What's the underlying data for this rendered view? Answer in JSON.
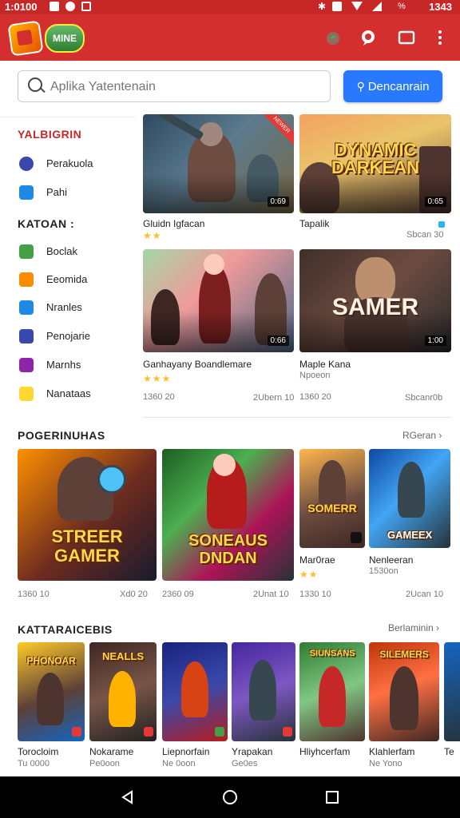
{
  "status_bar": {
    "time": "1:0100",
    "right": "1343"
  },
  "app_bar": {
    "logo_text": "MINE",
    "icons": [
      "tag-icon",
      "chat-icon",
      "window-icon",
      "more-icon"
    ]
  },
  "search": {
    "placeholder": "Aplika Yatentenain",
    "button_label": "Dencanrain"
  },
  "sidebar": {
    "section1_title": "YALBIGRIN",
    "section1_items": [
      {
        "label": "Perakuola",
        "icon": "circle-icon",
        "color": "#3949ab"
      },
      {
        "label": "Pahi",
        "icon": "folder-icon",
        "color": "#1e88e5"
      }
    ],
    "section2_title": "KATOAN :",
    "section2_items": [
      {
        "label": "Boclak",
        "icon": "book-icon",
        "color": "#43a047"
      },
      {
        "label": "Eeomida",
        "icon": "box-icon",
        "color": "#fb8c00"
      },
      {
        "label": "Nranles",
        "icon": "chart-icon",
        "color": "#1e88e5"
      },
      {
        "label": "Penojarie",
        "icon": "game-icon",
        "color": "#3949ab"
      },
      {
        "label": "Marnhs",
        "icon": "game-icon",
        "color": "#8e24aa"
      },
      {
        "label": "Nanataas",
        "icon": "puzzle-icon",
        "color": "#fdd835"
      }
    ]
  },
  "featured": [
    {
      "title": "Gluidn Igfacan",
      "rating": "★★",
      "sub_left": "",
      "sub_right": "",
      "badge": "0:69",
      "ribbon": "NEWER",
      "art": ""
    },
    {
      "title": "Tapalik",
      "rating": "",
      "sub_left": "",
      "sub_right": "Sbcan 30",
      "badge": "0:65",
      "ribbon": "",
      "art": "DYNAMIC DARKEAN"
    },
    {
      "title": "Ganhayany Boandlemare",
      "rating": "★★★",
      "sub_left": "1360 20",
      "sub_right": "2Ubern 10",
      "badge": "0:66",
      "ribbon": "",
      "art": ""
    },
    {
      "title": "Maple Kana",
      "rating": "",
      "sub_left": "Npoeon",
      "sub_right": "Sbcanr0b",
      "sub2": "1360 20",
      "badge": "1:00",
      "ribbon": "",
      "art": "SAMER"
    }
  ],
  "popular": {
    "title": "POGERINUHAS",
    "link": "RGeran",
    "items": [
      {
        "title": "",
        "art": "STREER GAMER",
        "sub_left": "1360 10",
        "sub_right": "Xd0 20"
      },
      {
        "title": "",
        "art": "SONEAUS DNDAN",
        "sub_left": "2360 09",
        "sub_right": "2Unat 10"
      },
      {
        "title": "Mar0rae",
        "rating": "★★",
        "art": "SOMERR",
        "sub_left": "1330 10"
      },
      {
        "title": "Nenleeran",
        "rating": "",
        "art": "GAMEEX",
        "sub_left": "1530on",
        "sub_right": "2Ucan 10"
      }
    ]
  },
  "categories": {
    "title": "KATTARAICEBIS",
    "link": "Berlaminin",
    "items": [
      {
        "title": "Torocloim",
        "sub": "Tu 0000",
        "art": "PHONOAR"
      },
      {
        "title": "Nokarame",
        "sub": "Pe0oon",
        "art": "NEALLS"
      },
      {
        "title": "Liepnorfain",
        "sub": "Ne 0oon",
        "art": ""
      },
      {
        "title": "Yrapakan",
        "sub": "Ge0es",
        "art": ""
      },
      {
        "title": "Hliyhcerfam",
        "sub": "",
        "art": "SIUNSANS"
      },
      {
        "title": "Klahlerfam",
        "sub": "Ne Yono",
        "art": "SILEMERS"
      },
      {
        "title": "Te",
        "sub": "",
        "art": ""
      }
    ]
  },
  "colors": {
    "brand": "#d32f2f",
    "accent": "#2979ff"
  }
}
